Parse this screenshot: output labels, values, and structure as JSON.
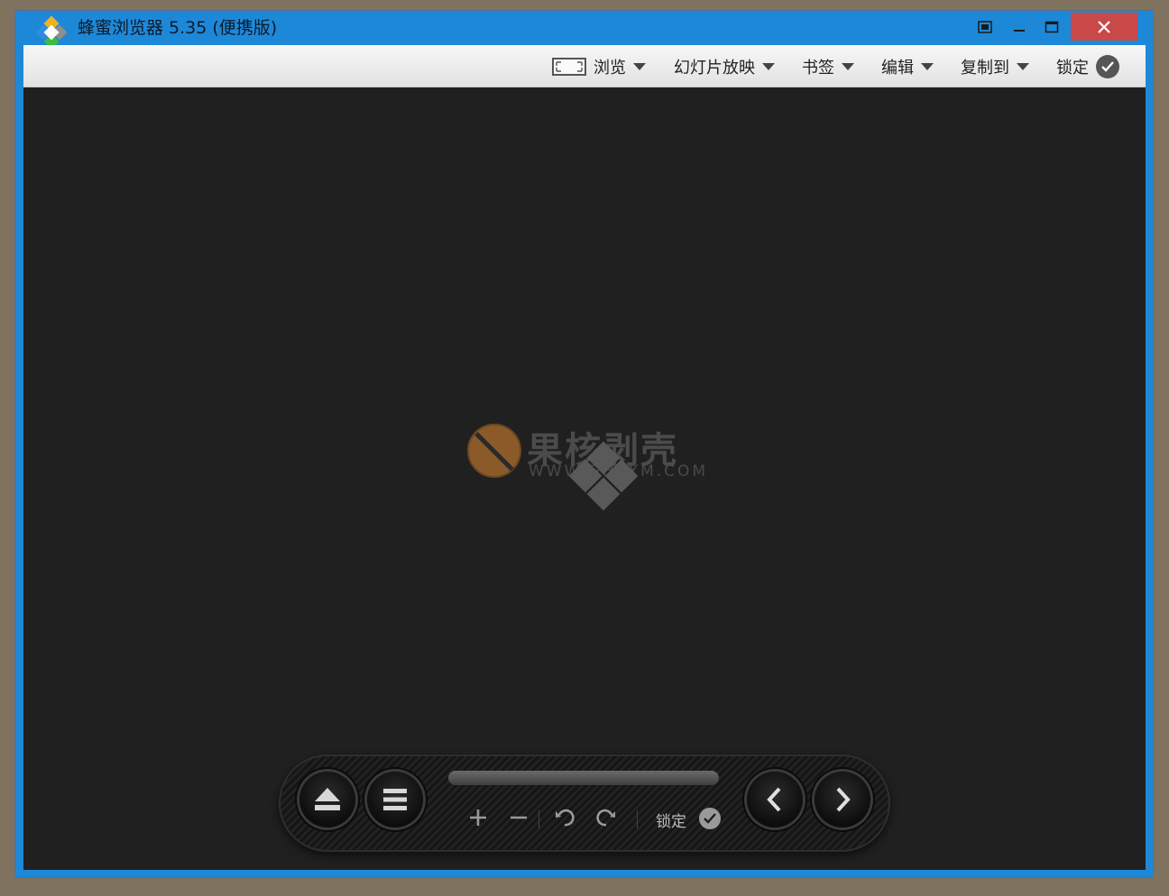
{
  "window": {
    "title": "蜂蜜浏览器 5.35 (便携版)"
  },
  "toolbar": {
    "items": [
      {
        "label": "浏览",
        "icon": "fit-screen-icon"
      },
      {
        "label": "幻灯片放映"
      },
      {
        "label": "书签"
      },
      {
        "label": "编辑"
      },
      {
        "label": "复制到"
      },
      {
        "label": "锁定",
        "icon": "check-circle-icon"
      }
    ]
  },
  "watermark": {
    "brand": "果核剥壳",
    "url": "WWW.GHPYM.COM"
  },
  "controlbar": {
    "lock_label": "锁定",
    "icons": [
      "eject-icon",
      "menu-icon",
      "zoom-in-icon",
      "zoom-out-icon",
      "rotate-left-icon",
      "rotate-right-icon",
      "check-circle-icon",
      "previous-icon",
      "next-icon"
    ]
  },
  "colors": {
    "title_bar": "#1e88d8",
    "close_button": "#c94848",
    "viewer_background": "#202020"
  }
}
